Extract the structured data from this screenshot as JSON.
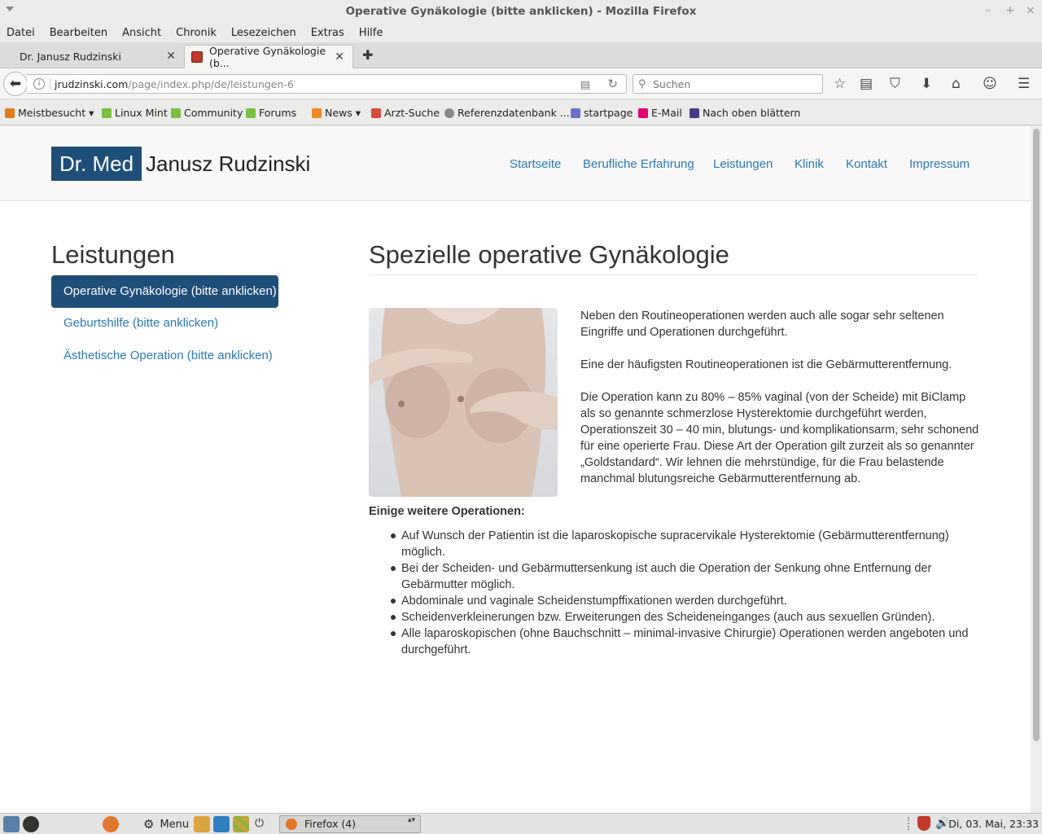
{
  "window": {
    "title": "Operative Gynäkologie (bitte anklicken) - Mozilla Firefox",
    "minimize": "–",
    "maximize": "+",
    "close": "×"
  },
  "menubar": [
    "Datei",
    "Bearbeiten",
    "Ansicht",
    "Chronik",
    "Lesezeichen",
    "Extras",
    "Hilfe"
  ],
  "tabs": [
    {
      "label": "Dr. Janusz Rudzinski",
      "close": "✕"
    },
    {
      "label": "Operative Gynäkologie (b...",
      "close": "✕"
    }
  ],
  "new_tab": "✚",
  "navbar": {
    "back": "⬅",
    "info": "i",
    "url_domain": "jrudzinski.com",
    "url_path": "/page/index.php/de/leistungen-6",
    "reader": "▤",
    "reload": "↻",
    "search_icon": "⚲",
    "search_placeholder": "Suchen",
    "icons": [
      "star-icon",
      "reading-list-icon",
      "pocket-icon",
      "download-icon",
      "home-icon",
      "chat-icon",
      "hamburger-menu-icon"
    ],
    "icon_glyphs": [
      "☆",
      "▤",
      "⛉",
      "⬇",
      "⌂",
      "☺",
      "☰"
    ]
  },
  "bookmarks": [
    {
      "label": "Meistbesucht ▾",
      "color": "#e07b1a"
    },
    {
      "label": "Linux Mint",
      "color": "#7ac142"
    },
    {
      "label": "Community",
      "color": "#7ac142"
    },
    {
      "label": "Forums",
      "color": "#7ac142"
    },
    {
      "label": "News ▾",
      "color": "#f08a24"
    },
    {
      "label": "Arzt-Suche",
      "color": "#d84a3a"
    },
    {
      "label": "Referenzdatenbank ...",
      "color": "#888888"
    },
    {
      "label": "startpage",
      "color": "#6b6fce"
    },
    {
      "label": "E-Mail",
      "color": "#e20074"
    },
    {
      "label": "Nach oben blättern",
      "color": "#4a3a8a"
    }
  ],
  "site": {
    "brand_box": "Dr. Med",
    "brand_name": "Janusz Rudzinski",
    "nav": [
      "Startseite",
      "Berufliche Erfahrung",
      "Leistungen",
      "Klinik",
      "Kontakt",
      "Impressum"
    ]
  },
  "sidebar": {
    "title": "Leistungen",
    "items": [
      {
        "label": "Operative Gynäkologie (bitte anklicken)",
        "active": true
      },
      {
        "label": "Geburtshilfe (bitte anklicken)",
        "active": false
      },
      {
        "label": "Ästhetische Operation (bitte anklicken)",
        "active": false
      }
    ]
  },
  "main": {
    "title": "Spezielle operative Gynäkologie",
    "paragraphs": [
      "Neben den Routineoperationen werden auch alle sogar sehr seltenen Eingriffe und Operationen durchgeführt.",
      "Eine der häufigsten Routineoperationen ist die Gebärmutterentfernung.",
      "Die Operation kann zu 80% – 85% vaginal (von der Scheide) mit BiClamp als so genannte schmerzlose Hysterektomie durchgeführt werden, Operationszeit 30 – 40 min, blutungs- und komplikationsarm, sehr schonend für eine operierte Frau. Diese Art der Operation gilt zurzeit als so genannter „Goldstandard“. Wir lehnen die mehrstündige, für die Frau belastende manchmal blutungsreiche Gebärmutterentfernung ab."
    ],
    "list_heading": "Einige weitere Operationen:",
    "list": [
      "Auf Wunsch der Patientin ist die laparoskopische supracervikale Hysterektomie (Gebärmutterentfernung) möglich.",
      "Bei der Scheiden- und Gebärmuttersenkung ist auch die Operation der Senkung ohne Entfernung der Gebärmutter möglich.",
      "Abdominale und vaginale Scheidenstumpffixationen werden durchgeführt.",
      "Scheidenverkleinerungen bzw. Erweiterungen des Scheideneinganges (auch aus sexuellen Gründen).",
      "Alle laparoskopischen (ohne Bauchschnitt – minimal-invasive Chirurgie) Operationen werden angeboten und durchgeführt."
    ]
  },
  "taskbar": {
    "menu_label": "Menu",
    "menu_icon": "⚙",
    "power_icon": "⏻",
    "task_label": "Firefox (4)",
    "task_arrows": "▴▾",
    "clock": "Di, 03. Mai, 23:33",
    "volume_icon": "🔊"
  }
}
